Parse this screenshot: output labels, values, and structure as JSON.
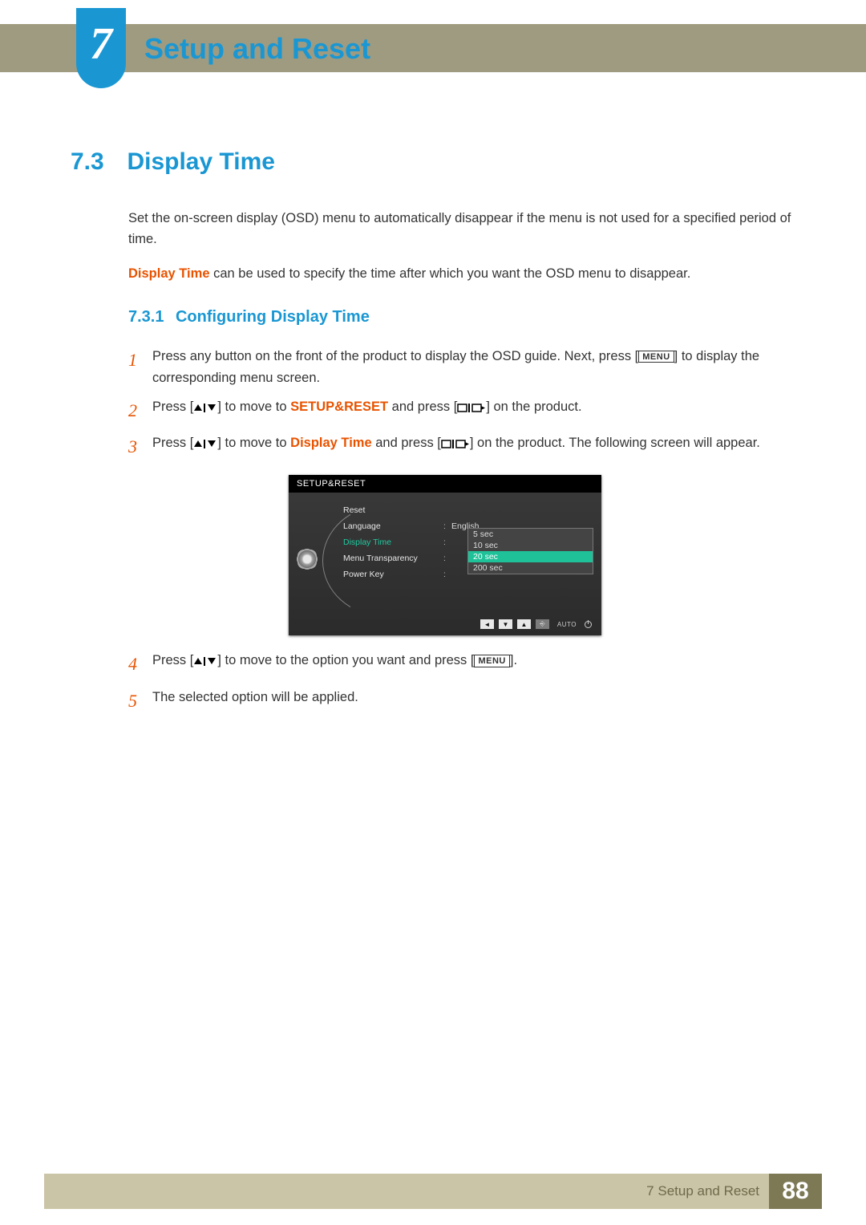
{
  "chapter": {
    "num": "7",
    "title": "Setup and Reset"
  },
  "section": {
    "num": "7.3",
    "title": "Display Time"
  },
  "intro": {
    "p1": "Set the on-screen display (OSD) menu to automatically disappear if the menu is not used for a specified period of time.",
    "p2_lead": "Display Time",
    "p2_rest": " can be used to specify the time after which you want the OSD menu to disappear."
  },
  "subsection": {
    "num": "7.3.1",
    "title": "Configuring Display Time"
  },
  "steps": {
    "s1_a": "Press any button on the front of the product to display the OSD guide. Next, press [",
    "s1_b": "] to display the corresponding menu screen.",
    "s2_a": "Press [",
    "s2_b": "] to move to ",
    "s2_kw": "SETUP&RESET",
    "s2_c": " and press [",
    "s2_d": "] on the product.",
    "s3_a": "Press [",
    "s3_b": "] to move to ",
    "s3_kw": "Display Time",
    "s3_c": " and press [",
    "s3_d": "] on the product. The following screen will appear.",
    "s4_a": "Press [",
    "s4_b": "] to move to the option you want and press [",
    "s4_c": "].",
    "s5": "The selected option will be applied.",
    "num1": "1",
    "num2": "2",
    "num3": "3",
    "num4": "4",
    "num5": "5",
    "menu_label": "MENU"
  },
  "osd": {
    "title": "SETUP&RESET",
    "rows": {
      "reset": "Reset",
      "language": "Language",
      "language_val": "English",
      "display_time": "Display Time",
      "menu_trans": "Menu Transparency",
      "power_key": "Power Key"
    },
    "options": [
      "5 sec",
      "10 sec",
      "20 sec",
      "200 sec"
    ],
    "selected_index": 2,
    "nav_auto": "AUTO"
  },
  "footer": {
    "text": "7 Setup and Reset",
    "page": "88"
  }
}
